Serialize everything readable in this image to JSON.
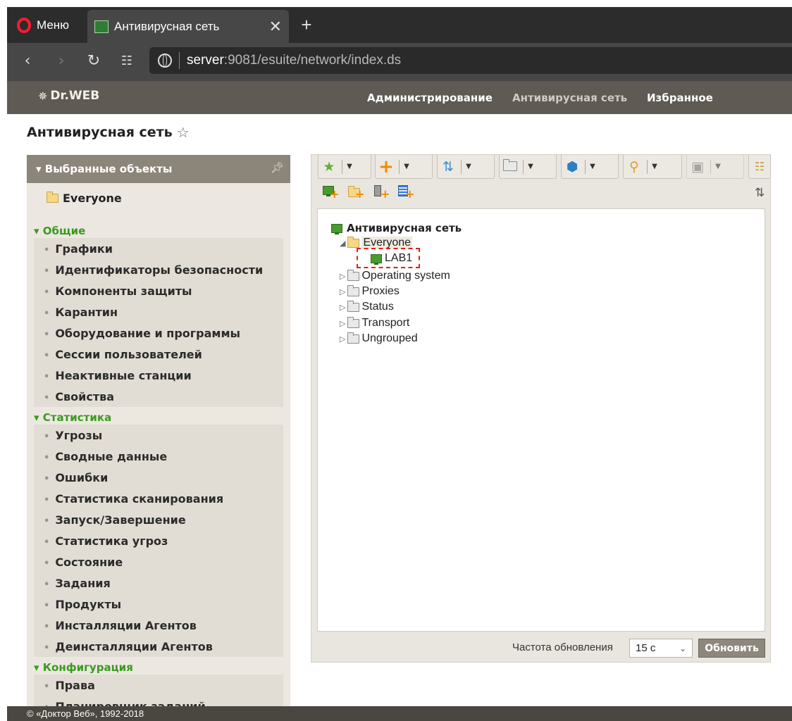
{
  "browser": {
    "menu_label": "Меню",
    "tab_title": "Антивирусная сеть",
    "tab_close": "✕",
    "new_tab": "+",
    "url_host": "server",
    "url_rest": ":9081/esuite/network/index.ds"
  },
  "app": {
    "logo": "Dr.WEB",
    "nav": {
      "admin": "Администрирование",
      "network": "Антивирусная сеть",
      "favorites": "Избранное"
    },
    "page_title": "Антивирусная сеть"
  },
  "sidebar": {
    "header": "Выбранные объекты",
    "selected_item": "Everyone",
    "sections": [
      {
        "title": "Общие",
        "items": [
          "Графики",
          "Идентификаторы безопасности",
          "Компоненты защиты",
          "Карантин",
          "Оборудование и программы",
          "Сессии пользователей",
          "Неактивные станции",
          "Свойства"
        ]
      },
      {
        "title": "Статистика",
        "items": [
          "Угрозы",
          "Сводные данные",
          "Ошибки",
          "Статистика сканирования",
          "Запуск/Завершение",
          "Статистика угроз",
          "Состояние",
          "Задания",
          "Продукты",
          "Инсталляции Агентов",
          "Деинсталляции Агентов"
        ]
      },
      {
        "title": "Конфигурация",
        "items": [
          "Права",
          "Планировщик заданий"
        ]
      }
    ]
  },
  "tree": {
    "root": "Антивирусная сеть",
    "everyone": "Everyone",
    "lab1": "LAB1",
    "groups": [
      "Operating system",
      "Proxies",
      "Status",
      "Transport",
      "Ungrouped"
    ]
  },
  "refresh": {
    "label": "Частота обновления",
    "value": "15 с",
    "button": "Обновить"
  },
  "footer": "© «Доктор Веб», 1992-2018"
}
